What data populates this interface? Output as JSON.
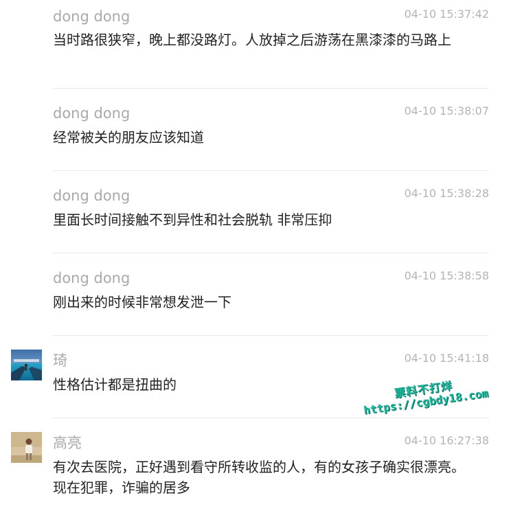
{
  "comments": [
    {
      "name": "dong dong",
      "time": "04-10 15:37:42",
      "text": "当时路很狭窄，晚上都没路灯。人放掉之后游荡在黑漆漆的马路上",
      "avatar": null
    },
    {
      "name": "dong dong",
      "time": "04-10 15:38:07",
      "text": "经常被关的朋友应该知道",
      "avatar": null
    },
    {
      "name": "dong dong",
      "time": "04-10 15:38:28",
      "text": "里面长时间接触不到异性和社会脱轨 非常压抑",
      "avatar": null
    },
    {
      "name": "dong dong",
      "time": "04-10 15:38:58",
      "text": "刚出来的时候非常想发泄一下",
      "avatar": null
    },
    {
      "name": "琦",
      "time": "04-10 15:41:18",
      "text": "性格估计都是扭曲的",
      "avatar": "sea-photo-avatar"
    },
    {
      "name": "高亮",
      "time": "04-10 16:27:38",
      "text": "有次去医院，正好遇到看守所转收监的人，有的女孩子确实很漂亮。现在犯罪，诈骗的居多",
      "avatar": "person-photo-avatar"
    }
  ],
  "watermark": {
    "line1": "票料不打烊",
    "line2": "https://cgbdy18.com"
  },
  "colors": {
    "name": "#a9a9a9",
    "time": "#b4b4b4",
    "text": "#222222",
    "divider": "#e9e9e9",
    "watermark": "#1dbb9f"
  }
}
